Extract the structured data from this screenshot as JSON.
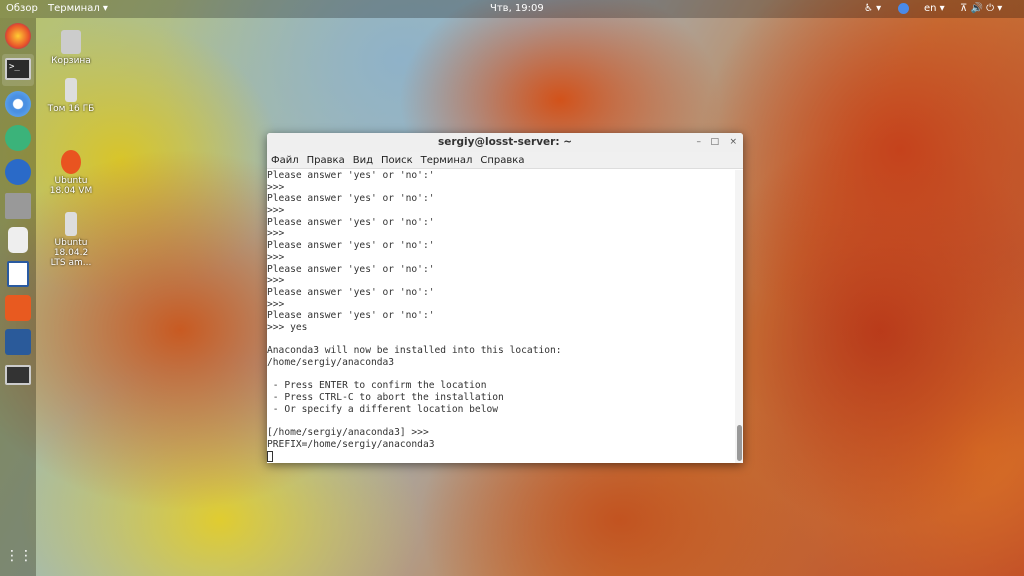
{
  "topbar": {
    "overview": "Обзор",
    "app": "Терминал ▾",
    "clock": "Чтв, 19:09",
    "lang": "en ▾",
    "accessibility": "♿ ▾",
    "system": "⊼ 🔊 ⏻ ▾"
  },
  "desktop": [
    {
      "label": "Корзина"
    },
    {
      "label": "Том 16 ГБ"
    },
    {
      "label": "Ubuntu 18.04 VM"
    },
    {
      "label": "Ubuntu 18.04.2 LTS am..."
    }
  ],
  "dock": [
    "firefox",
    "terminal",
    "chromium",
    "atom",
    "thunderbird",
    "files",
    "rhythmbox",
    "libreoffice-writer",
    "software-center",
    "virtualbox",
    "screenshot",
    "show-apps"
  ],
  "window": {
    "title": "sergiy@losst-server: ~",
    "minimize": "–",
    "maximize": "□",
    "close": "×",
    "menu": [
      "Файл",
      "Правка",
      "Вид",
      "Поиск",
      "Терминал",
      "Справка"
    ],
    "lines": [
      "Please answer 'yes' or 'no':'",
      ">>>",
      "Please answer 'yes' or 'no':'",
      ">>>",
      "Please answer 'yes' or 'no':'",
      ">>>",
      "Please answer 'yes' or 'no':'",
      ">>>",
      "Please answer 'yes' or 'no':'",
      ">>>",
      "Please answer 'yes' or 'no':'",
      ">>>",
      "Please answer 'yes' or 'no':'",
      ">>> yes",
      "",
      "Anaconda3 will now be installed into this location:",
      "/home/sergiy/anaconda3",
      "",
      " - Press ENTER to confirm the location",
      " - Press CTRL-C to abort the installation",
      " - Or specify a different location below",
      "",
      "[/home/sergiy/anaconda3] >>>",
      "PREFIX=/home/sergiy/anaconda3"
    ]
  }
}
